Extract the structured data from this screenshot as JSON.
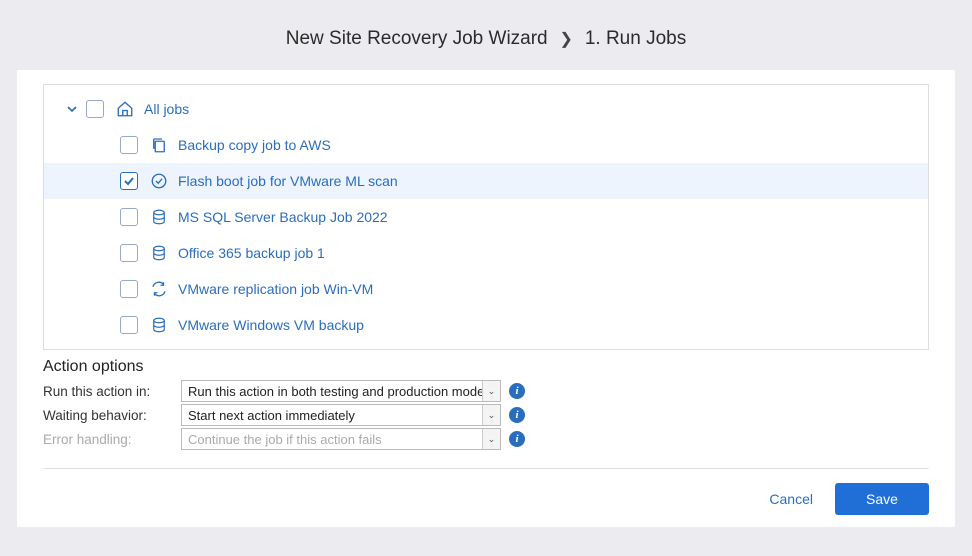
{
  "header": {
    "title": "New Site Recovery Job Wizard",
    "step": "1. Run Jobs"
  },
  "tree": {
    "root_label": "All jobs",
    "items": [
      {
        "label": "Backup copy job to AWS",
        "checked": false,
        "icon": "copy"
      },
      {
        "label": "Flash boot job for VMware ML scan",
        "checked": true,
        "icon": "flash"
      },
      {
        "label": "MS SQL Server Backup Job 2022",
        "checked": false,
        "icon": "db"
      },
      {
        "label": "Office 365 backup job 1",
        "checked": false,
        "icon": "db"
      },
      {
        "label": "VMware replication job Win-VM",
        "checked": false,
        "icon": "replicate"
      },
      {
        "label": "VMware Windows VM backup",
        "checked": false,
        "icon": "db"
      }
    ]
  },
  "options": {
    "section_title": "Action options",
    "run_label": "Run this action in:",
    "run_value": "Run this action in both testing and production mode",
    "wait_label": "Waiting behavior:",
    "wait_value": "Start next action immediately",
    "error_label": "Error handling:",
    "error_value": "Continue the job if this action fails"
  },
  "footer": {
    "cancel": "Cancel",
    "save": "Save"
  }
}
